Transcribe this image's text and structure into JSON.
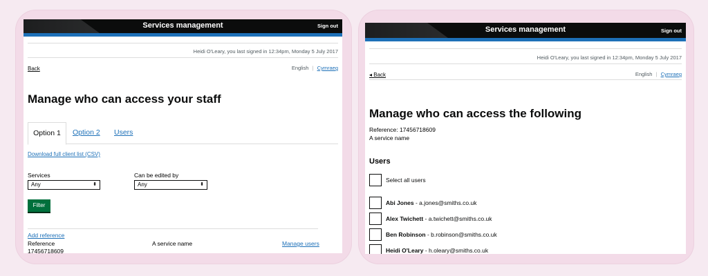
{
  "left": {
    "header": {
      "title": "Services management",
      "sign_out": "Sign out"
    },
    "signin_note": "Heidi O'Leary, you last signed in 12:34pm, Monday 5 July 2017",
    "back": "Back",
    "lang": {
      "english": "English",
      "separator": "|",
      "welsh": "Cymraeg"
    },
    "title": "Manage who can access your staff",
    "tabs": [
      {
        "label": "Option 1"
      },
      {
        "label": "Option 2"
      },
      {
        "label": "Users"
      }
    ],
    "download_link": "Download full client list (CSV)",
    "filters": {
      "services_label": "Services",
      "services_value": "Any",
      "edited_label": "Can be edited by",
      "edited_value": "Any"
    },
    "filter_button": "Filter",
    "table": {
      "add_reference": "Add reference",
      "reference_label": "Reference",
      "reference_value": "17456718609",
      "service_name": "A service name",
      "manage_users": "Manage users"
    }
  },
  "right": {
    "header": {
      "title": "Services management",
      "sign_out": "Sign out"
    },
    "signin_note": "Heidi O'Leary, you last signed in 12:34pm, Monday 5 July 2017",
    "back": "◂ Back",
    "lang": {
      "english": "English",
      "separator": "|",
      "welsh": "Cymraeg"
    },
    "title": "Manage who can access the following",
    "reference": "Reference: 17456718609",
    "service_name": "A service name",
    "users_heading": "Users",
    "select_all": "Select all users",
    "users": [
      {
        "name": "Abi Jones",
        "email": " - a.jones@smiths.co.uk"
      },
      {
        "name": "Alex Twichett",
        "email": " - a.twichett@smiths.co.uk"
      },
      {
        "name": "Ben Robinson",
        "email": " - b.robinson@smiths.co.uk"
      },
      {
        "name": "Heidi O'Leary",
        "email": " - h.oleary@smiths.co.uk"
      }
    ]
  }
}
